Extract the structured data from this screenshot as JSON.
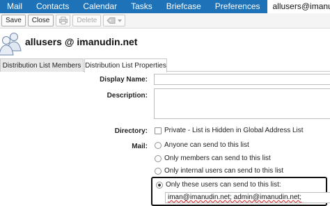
{
  "nav": {
    "tabs": [
      "Mail",
      "Contacts",
      "Calendar",
      "Tasks",
      "Briefcase",
      "Preferences"
    ],
    "account": "allusers@imanud"
  },
  "toolbar": {
    "save_label": "Save",
    "close_label": "Close",
    "delete_label": "Delete"
  },
  "header": {
    "title": "allusers @ imanudin.net"
  },
  "property_tabs": {
    "members": "Distribution List Members",
    "properties": "Distribution List Properties"
  },
  "form": {
    "display_name_label": "Display Name:",
    "display_name_value": "",
    "description_label": "Description:",
    "description_value": "",
    "directory_label": "Directory:",
    "directory_option": "Private - List is Hidden in Global Address List",
    "directory_checked": false,
    "mail_label": "Mail:",
    "mail_options": [
      "Anyone can send to this list",
      "Only members can send to this list",
      "Only internal users can send to this list",
      "Only these users can send to this list:"
    ],
    "mail_selected_index": 3,
    "allowed_senders": "iman@imanudin.net; admin@imanudin.net;"
  }
}
